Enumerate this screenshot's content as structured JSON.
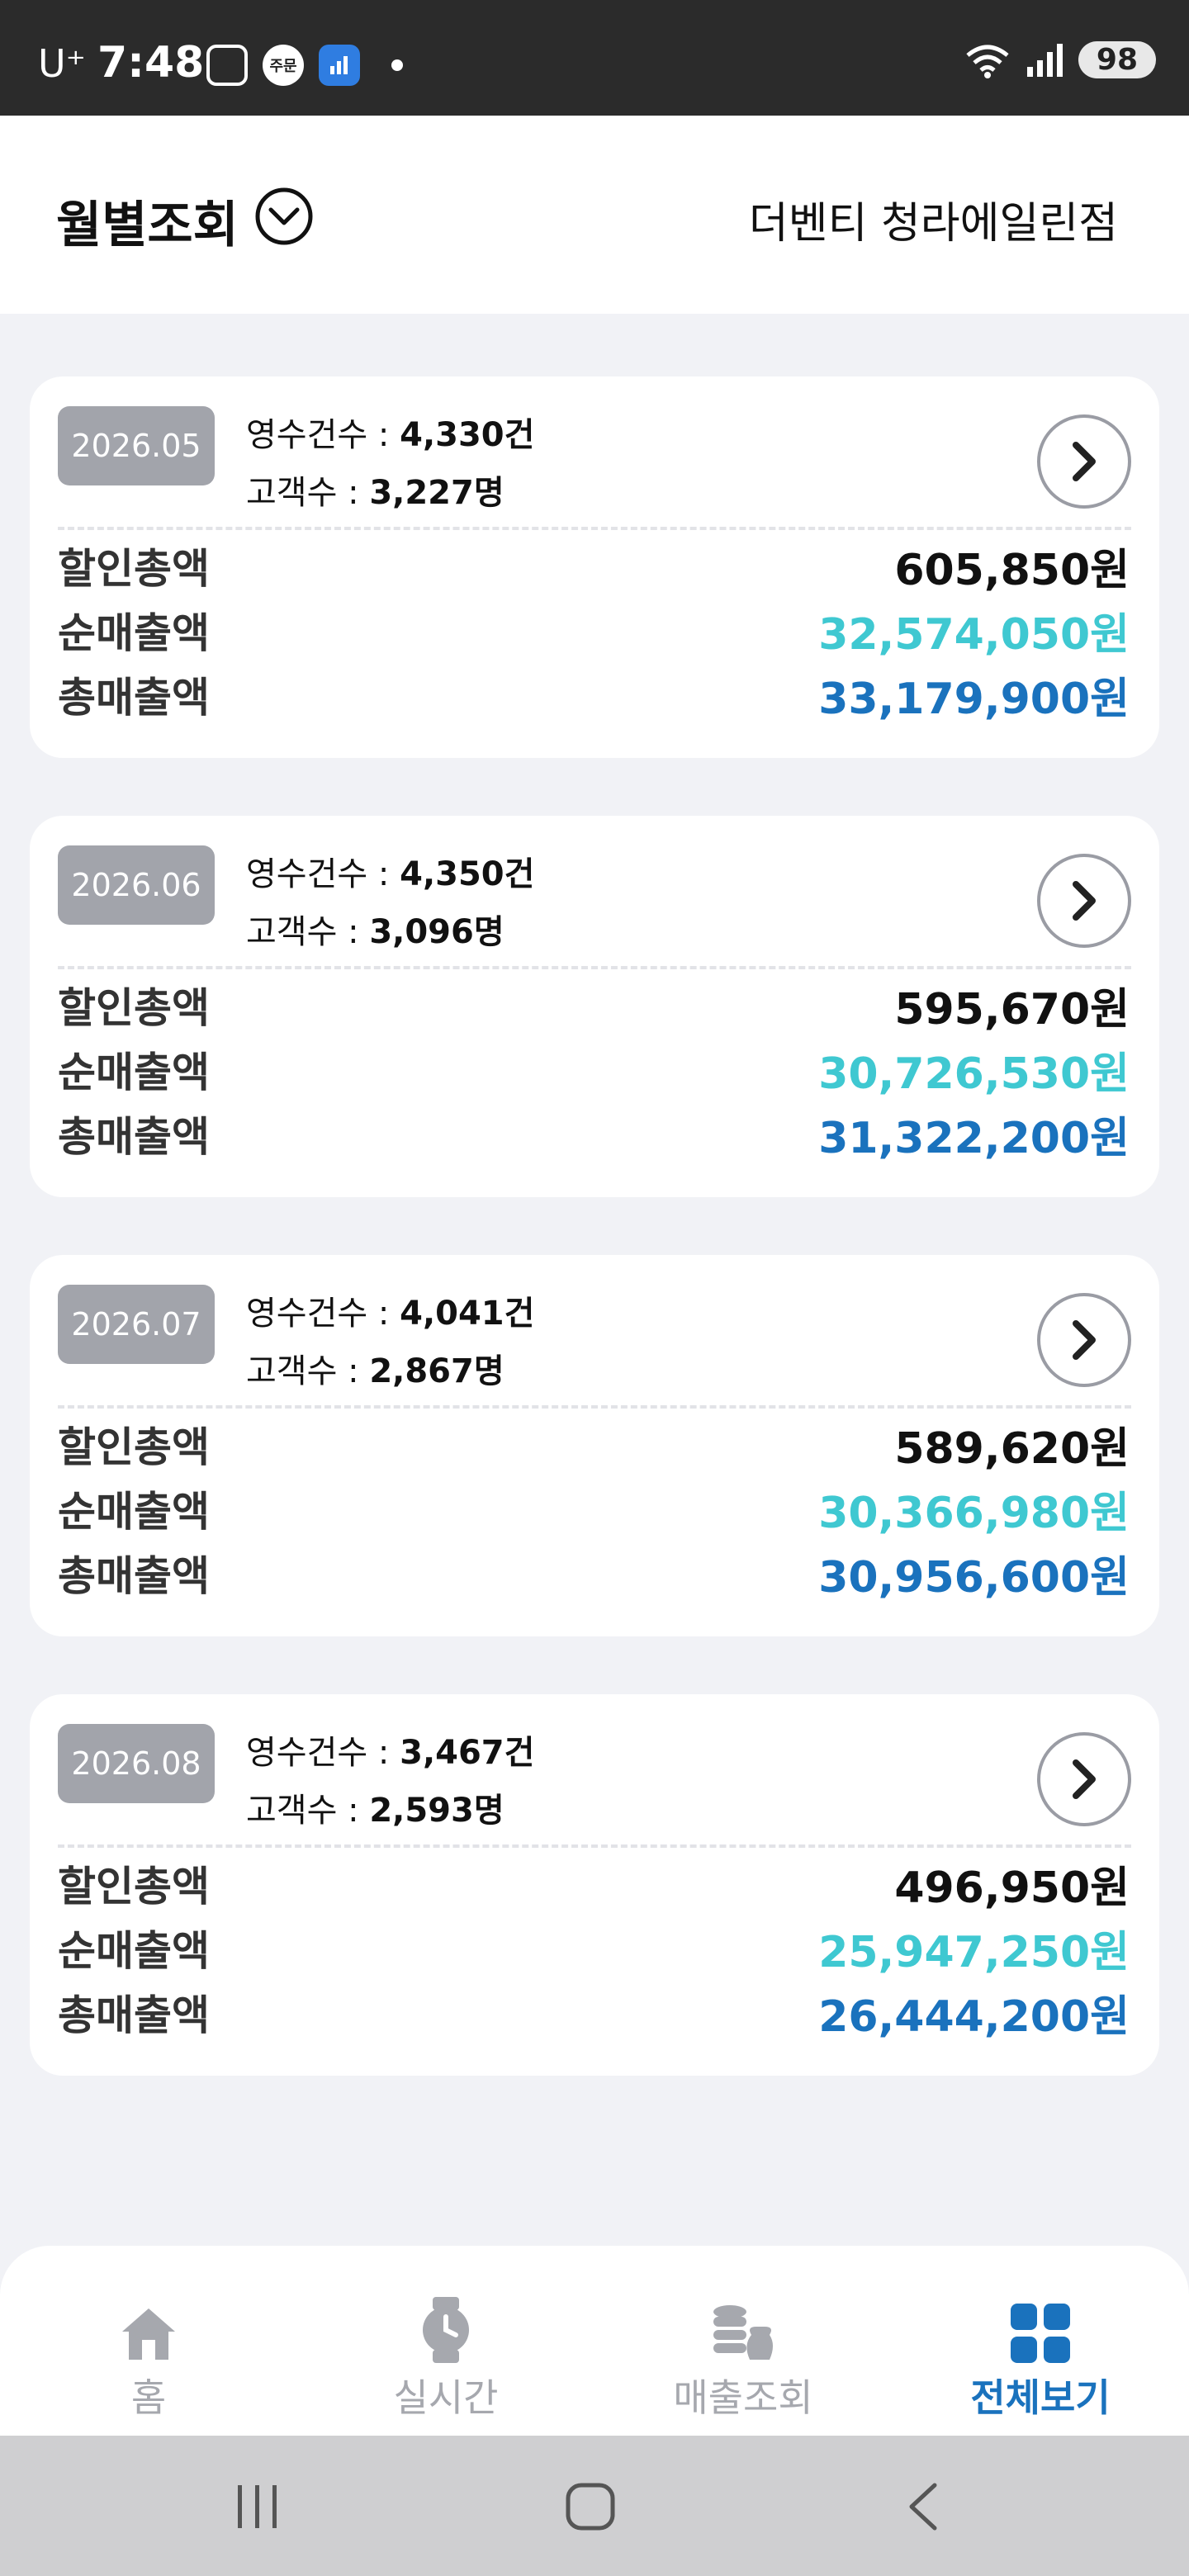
{
  "status_bar": {
    "carrier": "U⁺",
    "time": "7:48",
    "order_badge": "주문",
    "battery": "98"
  },
  "header": {
    "title": "월별조회",
    "store_name": "더벤티 청라에일린점"
  },
  "labels": {
    "receipts": "영수건수 : ",
    "customers": "고객수 : ",
    "discount_total": "할인총액",
    "net_sales": "순매출액",
    "gross_sales": "총매출액"
  },
  "months": [
    {
      "period": "2026.05",
      "receipts": "4,330건",
      "customers": "3,227명",
      "discount_total": "605,850원",
      "net_sales": "32,574,050원",
      "gross_sales": "33,179,900원"
    },
    {
      "period": "2026.06",
      "receipts": "4,350건",
      "customers": "3,096명",
      "discount_total": "595,670원",
      "net_sales": "30,726,530원",
      "gross_sales": "31,322,200원"
    },
    {
      "period": "2026.07",
      "receipts": "4,041건",
      "customers": "2,867명",
      "discount_total": "589,620원",
      "net_sales": "30,366,980원",
      "gross_sales": "30,956,600원"
    },
    {
      "period": "2026.08",
      "receipts": "3,467건",
      "customers": "2,593명",
      "discount_total": "496,950원",
      "net_sales": "25,947,250원",
      "gross_sales": "26,444,200원"
    }
  ],
  "bottom_nav": {
    "items": [
      {
        "label": "홈",
        "icon": "home-icon"
      },
      {
        "label": "실시간",
        "icon": "watch-icon"
      },
      {
        "label": "매출조회",
        "icon": "coins-icon"
      },
      {
        "label": "전체보기",
        "icon": "grid-icon",
        "active": true
      }
    ]
  },
  "colors": {
    "net_sales": "#3fc8d1",
    "gross_sales": "#1a72bd",
    "active_nav": "#1a72bd",
    "badge_bg": "#a2a4ab"
  }
}
